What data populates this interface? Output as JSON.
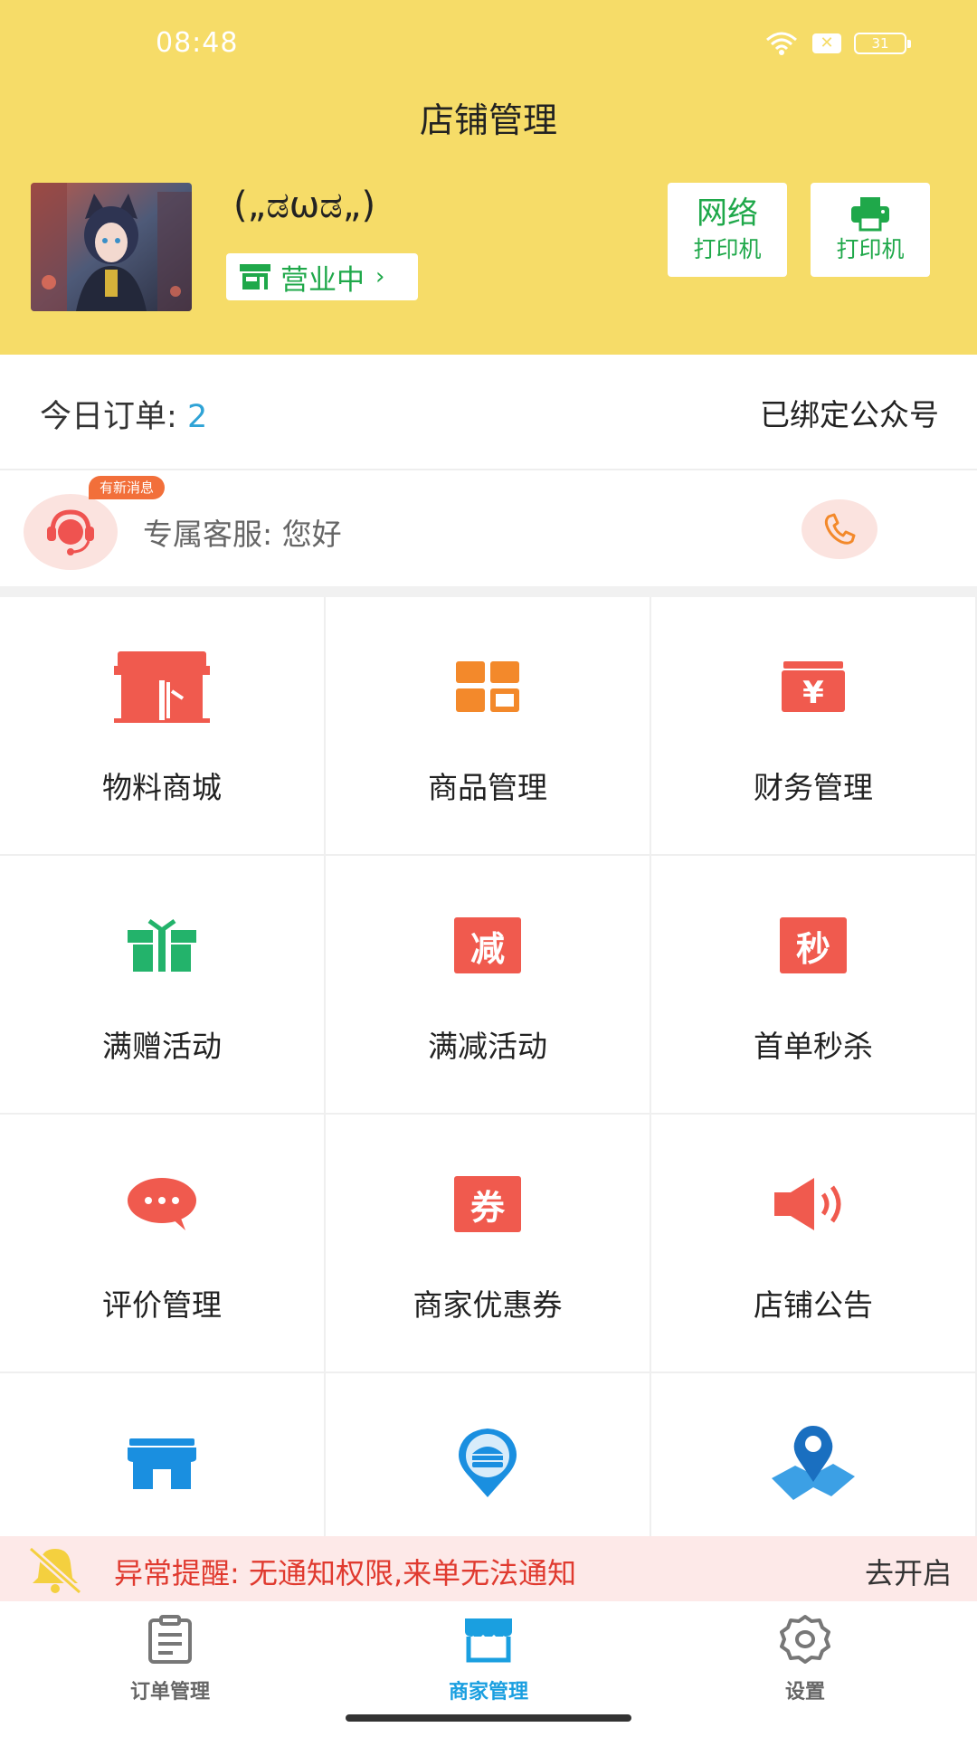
{
  "status_bar": {
    "time": "08:48",
    "battery": "31",
    "sim": "✕"
  },
  "header": {
    "title": "店铺管理",
    "shop_name": "(„ಡωಡ„)",
    "status_label": "营业中",
    "status_chevron": "›",
    "net_printer": {
      "line1": "网络",
      "line2": "打印机"
    },
    "printer": {
      "label": "打印机"
    }
  },
  "orders": {
    "label": "今日订单:",
    "count": "2",
    "bound": "已绑定公众号"
  },
  "service": {
    "badge": "有新消息",
    "text": "专属客服: 您好"
  },
  "grid": [
    {
      "label": "物料商城",
      "icon": "store-awning-icon"
    },
    {
      "label": "商品管理",
      "icon": "grid-squares-icon"
    },
    {
      "label": "财务管理",
      "icon": "yen-box-icon"
    },
    {
      "label": "满赠活动",
      "icon": "gift-icon"
    },
    {
      "label": "满减活动",
      "icon": "reduce-badge-icon",
      "glyph": "减"
    },
    {
      "label": "首单秒杀",
      "icon": "flash-sale-badge-icon",
      "glyph": "秒"
    },
    {
      "label": "评价管理",
      "icon": "chat-bubble-icon"
    },
    {
      "label": "商家优惠券",
      "icon": "coupon-badge-icon",
      "glyph": "券"
    },
    {
      "label": "店铺公告",
      "icon": "speaker-icon"
    },
    {
      "label": "",
      "icon": "shop-front-icon"
    },
    {
      "label": "",
      "icon": "location-pin-food-icon"
    },
    {
      "label": "",
      "icon": "map-pin-icon"
    }
  ],
  "alert": {
    "text": "异常提醒: 无通知权限,来单无法通知",
    "action": "去开启"
  },
  "tabs": [
    {
      "label": "订单管理",
      "icon": "clipboard-icon"
    },
    {
      "label": "商家管理",
      "icon": "shop-tab-icon",
      "active": true
    },
    {
      "label": "设置",
      "icon": "gear-icon"
    }
  ],
  "colors": {
    "header": "#f6dc68",
    "green": "#1fa84a",
    "red": "#f05a4e",
    "orange": "#f3892b",
    "blue": "#1a9fe0"
  }
}
